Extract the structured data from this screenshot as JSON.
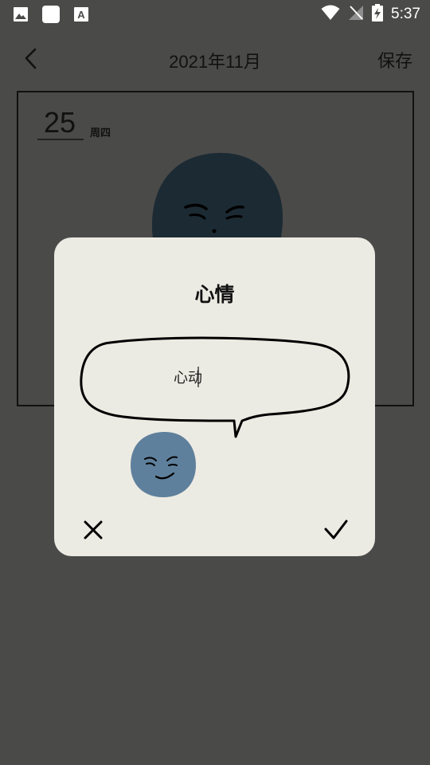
{
  "status_bar": {
    "time": "5:37",
    "left_icons": [
      "image-icon",
      "square-icon",
      "font-icon"
    ],
    "right_icons": [
      "wifi-icon",
      "no-signal-icon",
      "battery-charging-icon"
    ]
  },
  "header": {
    "title": "2021年11月",
    "save_label": "保存"
  },
  "entry": {
    "day": "25",
    "weekday": "周四"
  },
  "dialog": {
    "title": "心情",
    "mood_value": "心动"
  },
  "colors": {
    "overlay_bg": "#4a4a49",
    "dialog_bg": "#ecebe3",
    "face_dark": "#1c2a33",
    "face_blue": "#5f809c"
  }
}
